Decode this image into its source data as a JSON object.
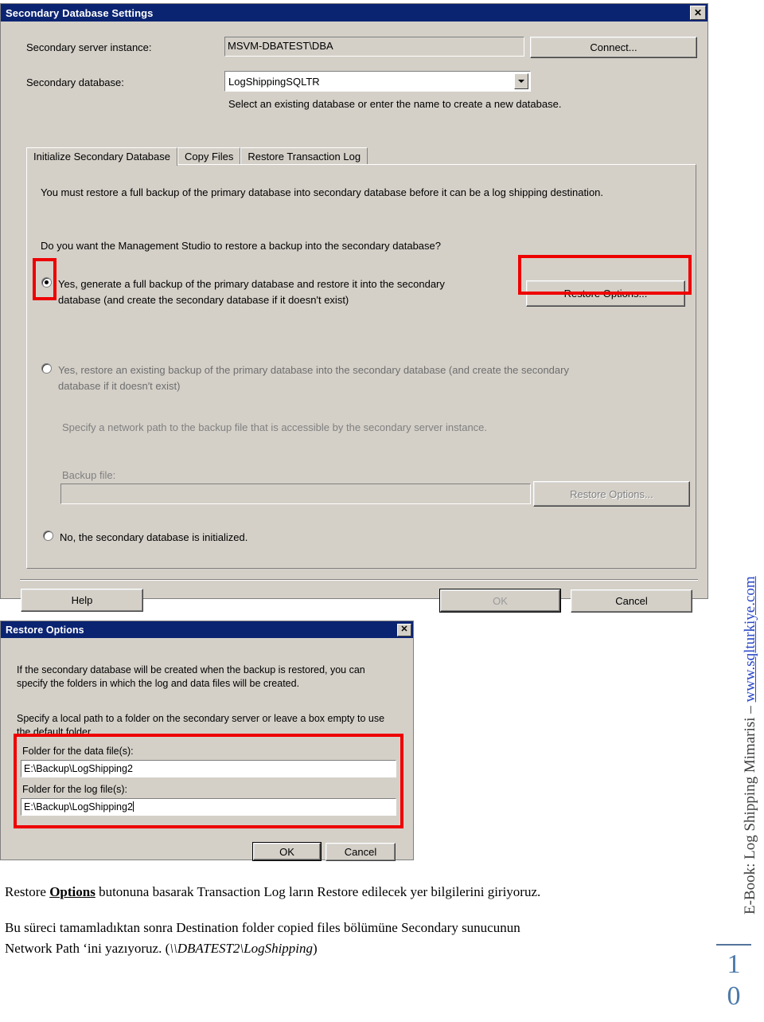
{
  "dialog_main": {
    "title": "Secondary Database Settings",
    "close_label": "✕",
    "server_instance_label": "Secondary server instance:",
    "server_instance_value": "MSVM-DBATEST\\DBA",
    "connect_button": "Connect...",
    "database_label": "Secondary database:",
    "database_value": "LogShippingSQLTR",
    "database_hint": "Select an existing database or enter the name to create a new database.",
    "tabs": [
      {
        "label": "Initialize Secondary Database",
        "active": true
      },
      {
        "label": "Copy Files",
        "active": false
      },
      {
        "label": "Restore Transaction Log",
        "active": false
      }
    ],
    "tab_intro": "You must restore a full backup of the primary database into secondary database before it can be a log shipping destination.",
    "tab_question": "Do you want the Management Studio to restore a backup into the secondary database?",
    "option1_line1": "Yes, generate a full backup of the primary database and restore it into the secondary",
    "option1_line2": "database (and create the secondary database if it doesn't exist)",
    "option1_checked": true,
    "restore_options_button_1": "Restore Options...",
    "option2_line1": "Yes, restore an existing backup of the primary database into the secondary database (and create the secondary",
    "option2_line2": "database if it doesn′t exist)",
    "option2_checked": false,
    "network_path_hint": "Specify a network path to the backup file that is accessible by the secondary server instance.",
    "backup_file_label": "Backup file:",
    "backup_file_value": "",
    "restore_options_button_2": "Restore Options...",
    "option3_label": "No, the secondary database is initialized.",
    "option3_checked": false,
    "help_button": "Help",
    "ok_button": "OK",
    "cancel_button": "Cancel"
  },
  "dialog_restore_options": {
    "title": "Restore Options",
    "close_label": "✕",
    "intro_line1": "If the secondary database will be created when the backup is restored, you can",
    "intro_line2": "specify the folders in which the log and data files will be created.",
    "intro2_line1": "Specify a local path to a folder on the secondary server or leave a box empty to use",
    "intro2_line2": "the default folder.",
    "data_folder_label": "Folder for the data file(s):",
    "data_folder_value": "E:\\Backup\\LogShipping2",
    "log_folder_label": "Folder for the log file(s):",
    "log_folder_value": "E:\\Backup\\LogShipping2",
    "ok_button": "OK",
    "cancel_button": "Cancel"
  },
  "annotations": {
    "highlight_color": "#ee0000"
  },
  "page_text": {
    "para1_a": "Restore ",
    "para1_bold": "Options",
    "para1_b": " butonuna basarak Transaction Log ların Restore edilecek yer bilgilerini giriyoruz.",
    "para2_line1": "Bu süreci tamamladıktan sonra  Destination folder copied files bölümüne Secondary sunucunun",
    "para2_line2_a": "Network Path ‘ini yazıyoruz.  (",
    "para2_line2_i": "\\\\DBATEST2\\LogShipping",
    "para2_line2_b": ")"
  },
  "sidebar": {
    "text_prefix": "E-Book: Log Shipping Mimarisi – ",
    "link_text": "www.sqlturkiye.com",
    "page_digit_1": "1",
    "page_digit_2": "0"
  }
}
